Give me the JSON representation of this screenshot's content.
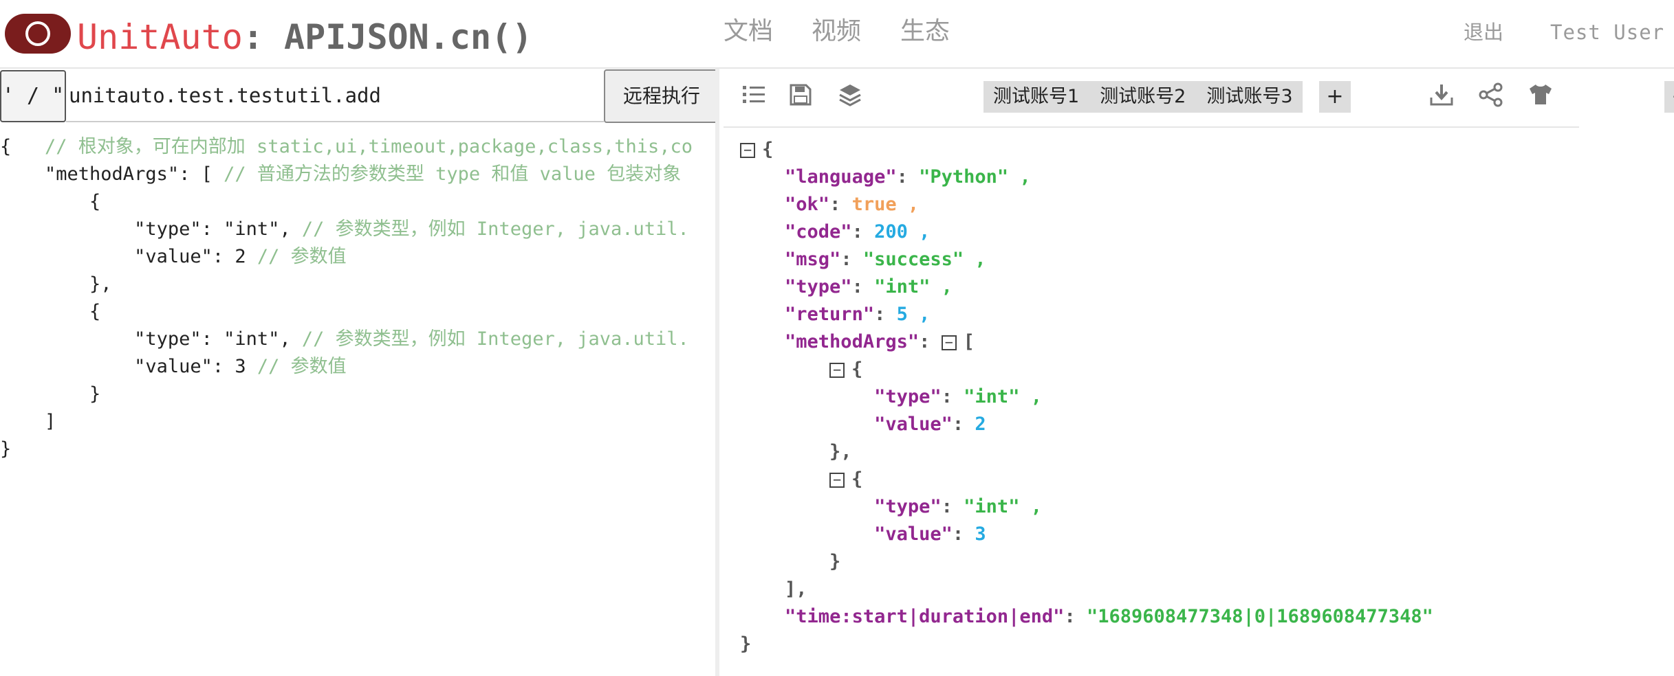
{
  "header": {
    "brand_app": "UnitAuto",
    "brand_rest": ": APIJSON.cn()",
    "nav": [
      "文档",
      "视频",
      "生态"
    ],
    "logout_label": "退出",
    "user_name": "Test User"
  },
  "request": {
    "type_button_label": "' / \"",
    "url_value": "unitauto.test.testutil.add",
    "run_button_label": "远程执行"
  },
  "editor": {
    "lines": [
      {
        "code": "{   ",
        "comment": "// 根对象，可在内部加 static,ui,timeout,package,class,this,co"
      },
      {
        "code": "    \"methodArgs\": [ ",
        "comment": "// 普通方法的参数类型 type 和值 value 包装对象"
      },
      {
        "code": "        {",
        "comment": ""
      },
      {
        "code": "            \"type\": \"int\", ",
        "comment": "// 参数类型，例如 Integer, java.util."
      },
      {
        "code": "            \"value\": 2 ",
        "comment": "// 参数值"
      },
      {
        "code": "        },",
        "comment": ""
      },
      {
        "code": "        {",
        "comment": ""
      },
      {
        "code": "            \"type\": \"int\", ",
        "comment": "// 参数类型，例如 Integer, java.util."
      },
      {
        "code": "            \"value\": 3 ",
        "comment": "// 参数值"
      },
      {
        "code": "        }",
        "comment": ""
      },
      {
        "code": "    ]",
        "comment": ""
      },
      {
        "code": "}",
        "comment": ""
      }
    ]
  },
  "toolbar": {
    "icons": [
      "list-icon",
      "save-icon",
      "layers-icon",
      "download-icon",
      "share-icon",
      "shirt-icon"
    ],
    "minus_label": "−",
    "plus_label": "+",
    "accounts": [
      "测试账号1",
      "测试账号2",
      "测试账号3"
    ]
  },
  "response": {
    "language": "Python",
    "ok": "true",
    "code": "200",
    "msg": "success",
    "type": "int",
    "return": "5",
    "arg1_type": "int",
    "arg1_value": "2",
    "arg2_type": "int",
    "arg2_value": "3",
    "time_key": "time:start|duration|end",
    "time_value": "1689608477348|0|1689608477348",
    "toggle_symbol": "−"
  },
  "colors": {
    "brand_red": "#e0474c",
    "logo_dark_red": "#7a1d1d",
    "json_key": "#92278f",
    "json_string": "#3ab54a",
    "json_number": "#25aae1",
    "json_bool": "#f1a05a",
    "comment": "#8fbf8f"
  }
}
